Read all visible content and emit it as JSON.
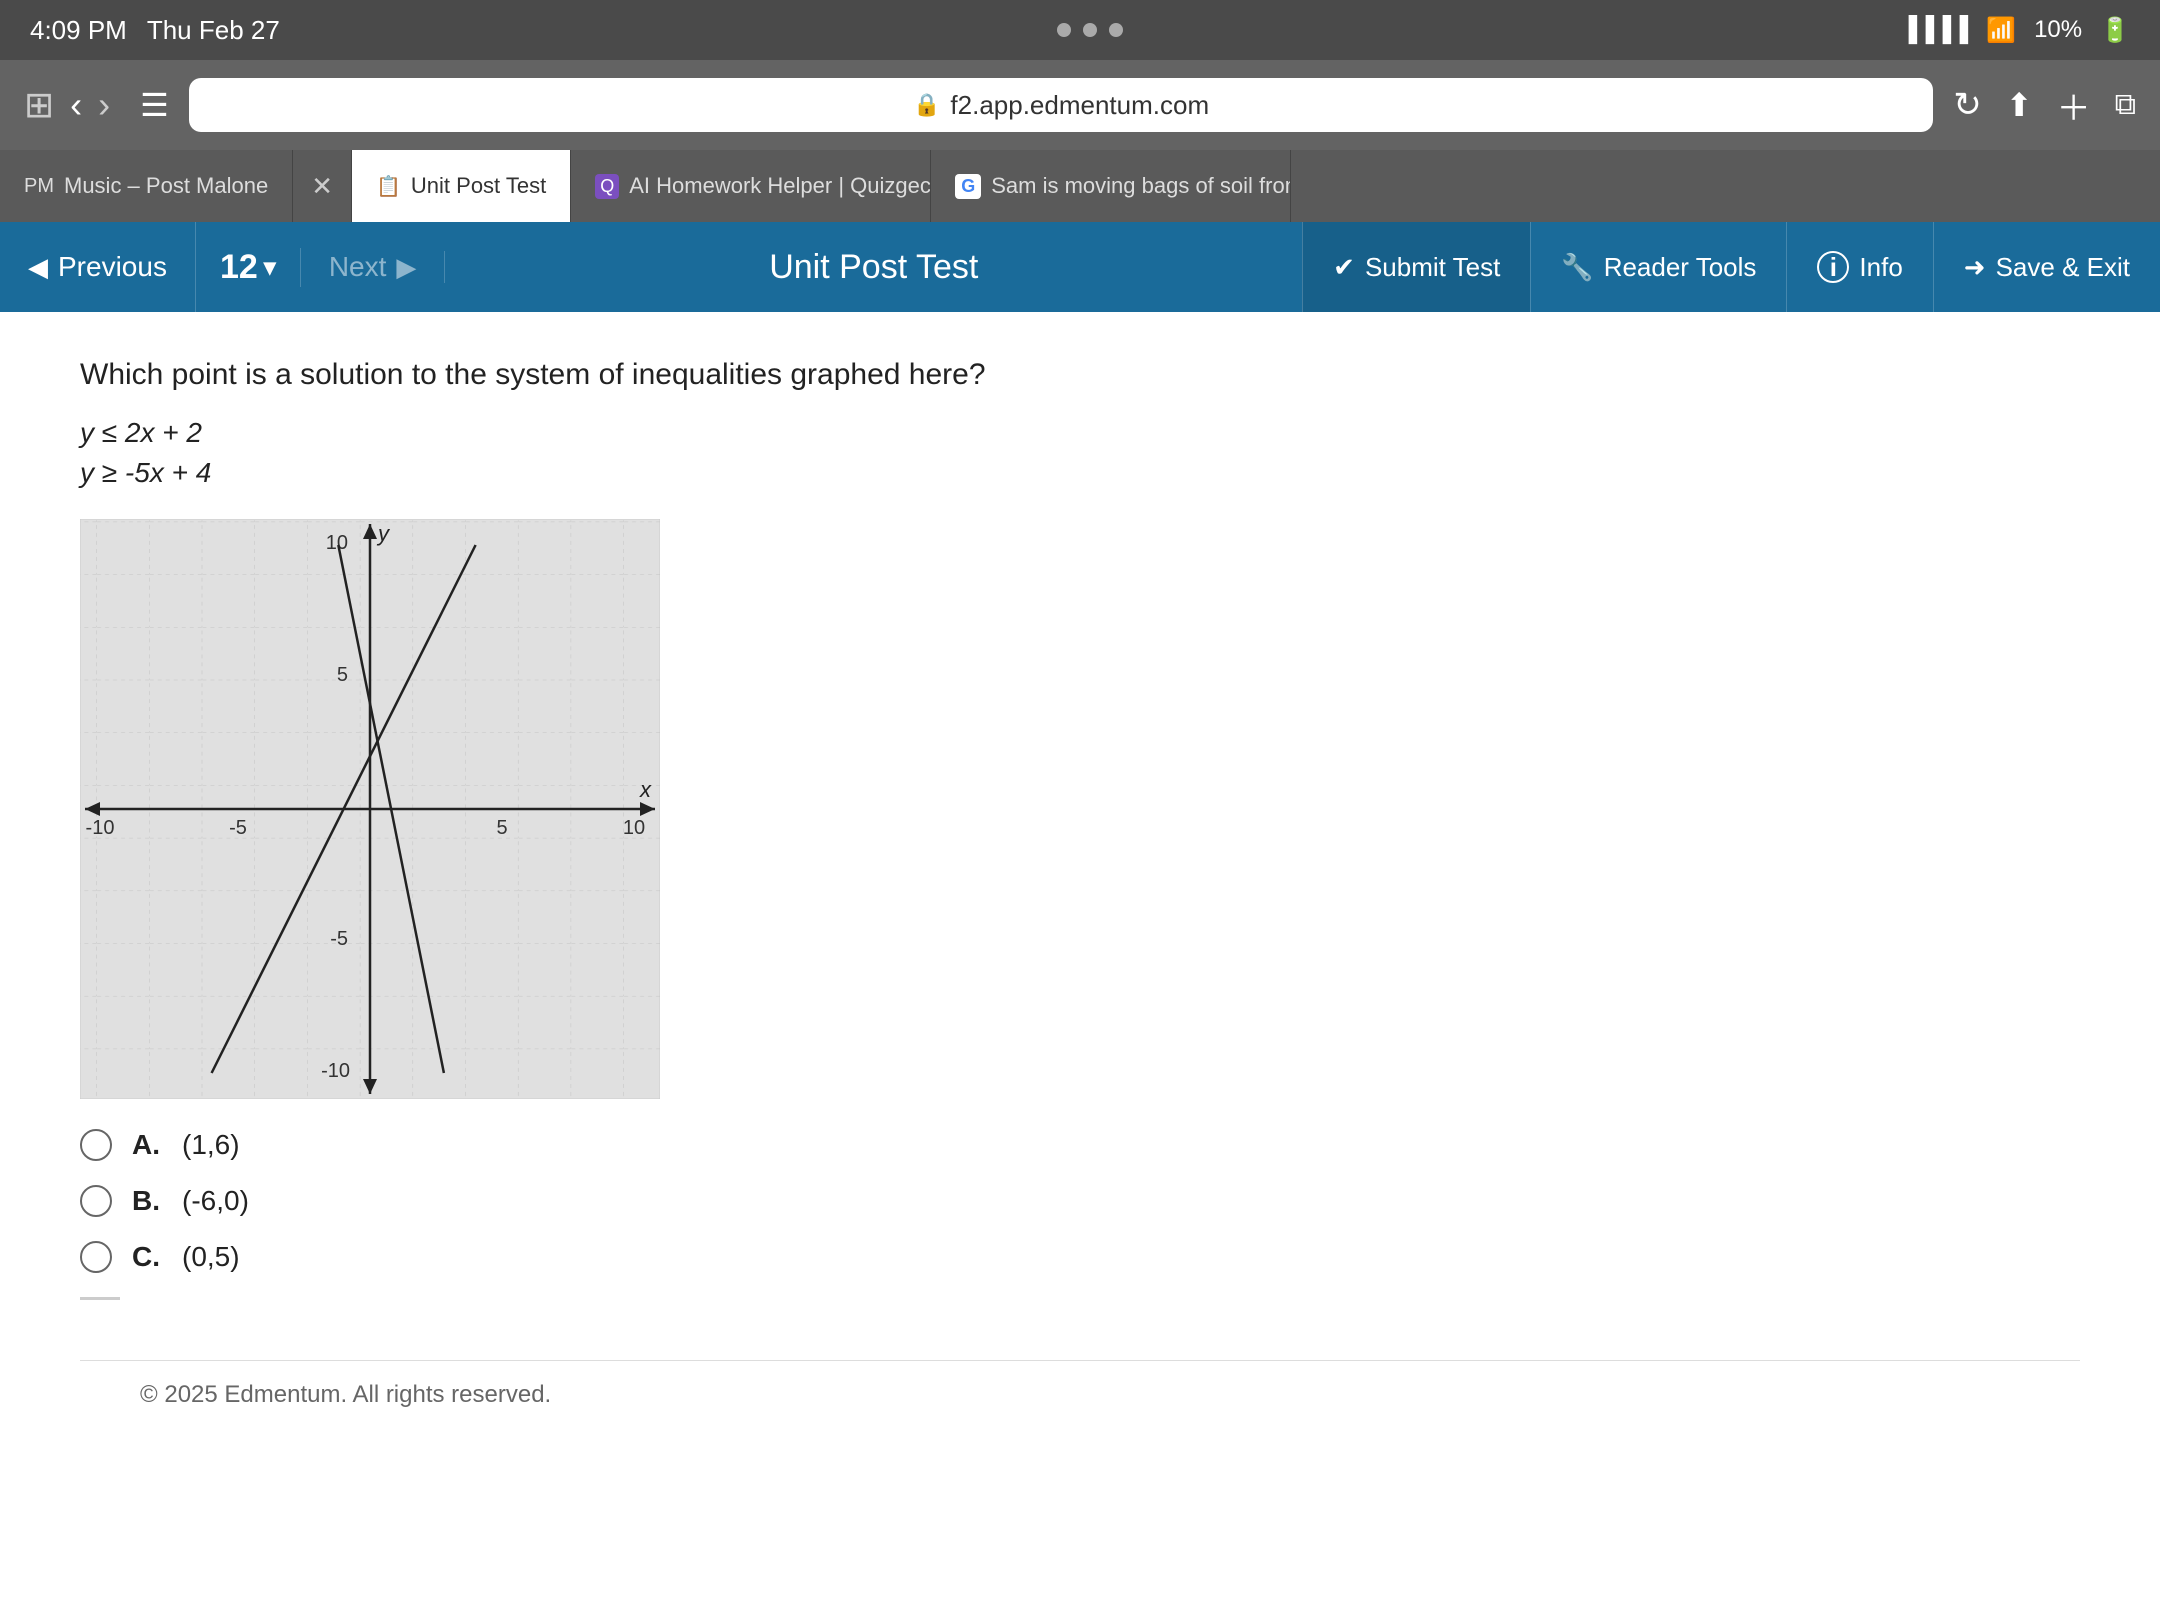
{
  "status": {
    "time": "4:09 PM",
    "date": "Thu Feb 27",
    "battery": "10%"
  },
  "browser": {
    "url": "f2.app.edmentum.com",
    "tabs": [
      {
        "id": "tab-music",
        "icon": "🎵",
        "label": "Music – Post Malone",
        "active": false
      },
      {
        "id": "tab-close",
        "icon": "✕",
        "label": "",
        "active": false
      },
      {
        "id": "tab-test",
        "icon": "📋",
        "label": "Unit Post Test",
        "active": true
      },
      {
        "id": "tab-ai",
        "icon": "🤖",
        "label": "AI Homework Helper | Quizgecko",
        "active": false
      },
      {
        "id": "tab-sam",
        "icon": "G",
        "label": "Sam is moving bags of soil from...",
        "active": false
      }
    ]
  },
  "navbar": {
    "prev_label": "Previous",
    "question_number": "12",
    "dropdown_arrow": "▾",
    "next_label": "Next",
    "title": "Unit Post Test",
    "submit_label": "Submit Test",
    "reader_tools_label": "Reader Tools",
    "info_label": "Info",
    "save_exit_label": "Save & Exit"
  },
  "question": {
    "prompt": "Which point is a solution to the system of inequalities graphed here?",
    "inequality1": "y ≤ 2x + 2",
    "inequality2": "y ≥ -5x + 4"
  },
  "answers": [
    {
      "letter": "A.",
      "value": "(1,6)"
    },
    {
      "letter": "B.",
      "value": "(-6,0)"
    },
    {
      "letter": "C.",
      "value": "(0,5)"
    }
  ],
  "footer": {
    "copyright": "© 2025 Edmentum. All rights reserved."
  }
}
